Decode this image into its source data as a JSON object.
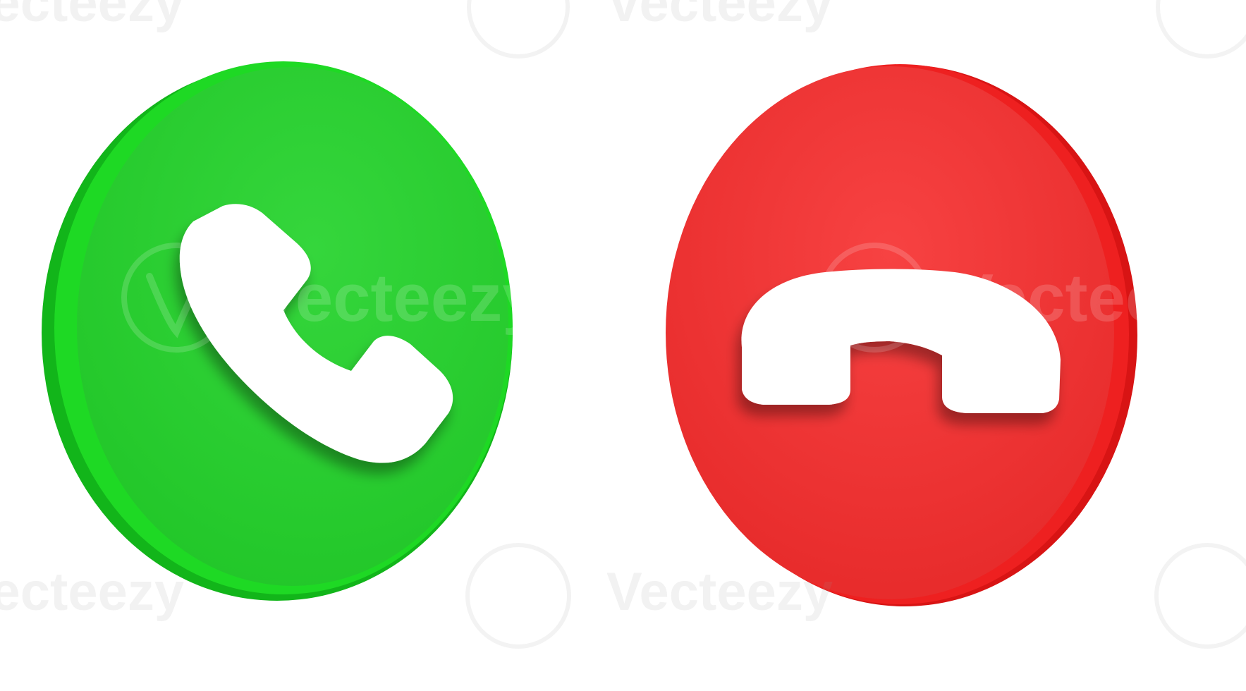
{
  "watermark": {
    "text": "Vecteezy",
    "logo_icon": "vecteezy-v-logo-icon"
  },
  "buttons": {
    "accept": {
      "icon": "phone-handset-icon",
      "face_color": "#2fd236",
      "side_color": "#12b51a",
      "rim_color": "#1ed924"
    },
    "decline": {
      "icon": "phone-hangup-icon",
      "face_color": "#f23a3a",
      "side_color": "#d81414",
      "rim_color": "#ee2020"
    }
  },
  "handset_color": "#ffffff"
}
